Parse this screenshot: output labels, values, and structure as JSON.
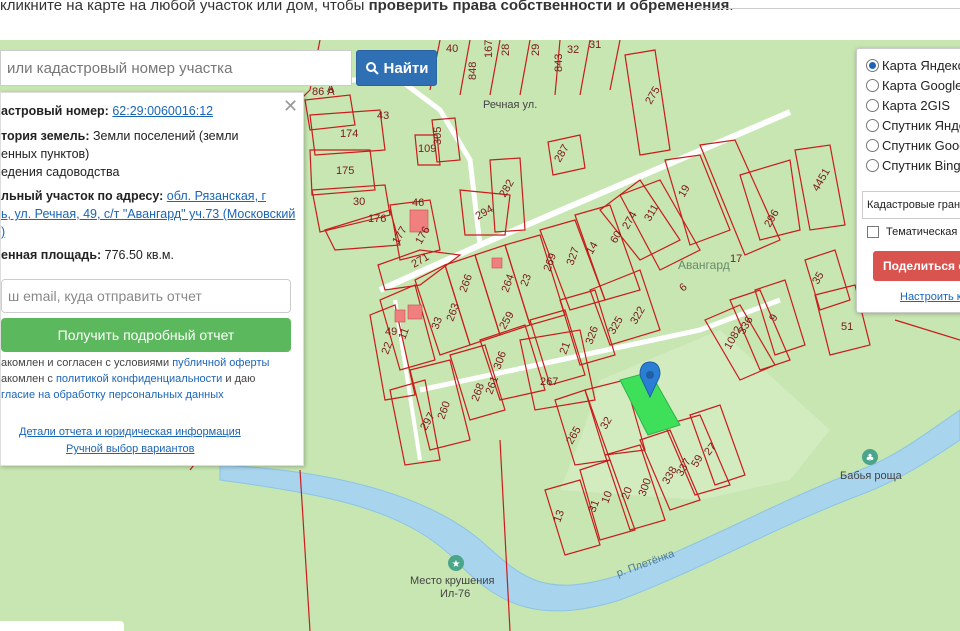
{
  "top_bar": {
    "text_prefix": "кликните на карте на любой участок или дом, чтобы ",
    "text_bold": "проверить права собственности и обременения",
    "text_suffix": "."
  },
  "search": {
    "placeholder": "или кадастровый номер участка",
    "button_label": "Найти"
  },
  "info": {
    "cadastral_label": "астровый номер: ",
    "cadastral_value": "62:29:0060016:12",
    "category_label": "тория земель: ",
    "category_value": "Земли поселений (земли",
    "category_value_2": "енных пунктов)",
    "use_value": "едения садоводства",
    "address_label": "льный участок по адресу: ",
    "address_value": "обл. Рязанская, г",
    "address_value_2": "ь, ул. Речная, 49, с/т \"Авангард\" уч.73 (Московский",
    "address_value_3": ")",
    "area_label": "енная площадь: ",
    "area_value": "776.50 кв.м.",
    "email_placeholder": "ш email, куда отправить отчет",
    "report_button": "Получить подробный отчет",
    "terms_1_prefix": "акомлен и согласен с условиями ",
    "terms_1_link": "публичной оферты",
    "terms_2_prefix": "акомлен с ",
    "terms_2_link": "политикой конфиденциальности",
    "terms_2_suffix": " и даю",
    "terms_3_link": "гласие на обработку персональных данных",
    "details_link": "Детали отчета и юридическая информация",
    "manual_link": "Ручной выбор вариантов"
  },
  "layers": {
    "options": [
      "Карта Яндекс",
      "Карта Google",
      "Карта 2GIS",
      "Спутник Яндекс",
      "Спутник Google",
      "Спутник Bing"
    ],
    "selected_index": 0,
    "select_value": "Кадастровые границы",
    "thematic_label": "Тематическая",
    "share_button": "Поделиться с",
    "setup_link": "Настроить к"
  },
  "map": {
    "colors": {
      "land": "#c7e6b2",
      "river": "#a8d4ee",
      "boundary": "#c91c1c",
      "selected": "#3ee05a",
      "marker": "#2a7fd4",
      "poi": "#4aa58a"
    },
    "street_label": "Речная ул.",
    "place_label": "Авангард",
    "river_label": "р. Плетёнка",
    "poi_1": "Бабья роща",
    "poi_2_line1": "Место крушения",
    "poi_2_line2": "Ил-76",
    "parcel_numbers": [
      "40",
      "167",
      "28",
      "29",
      "843",
      "32",
      "31",
      "86 А",
      "848",
      "174",
      "175",
      "30",
      "176",
      "177",
      "46",
      "176",
      "271",
      "109",
      "305",
      "287",
      "282",
      "294",
      "275",
      "311",
      "274",
      "60",
      "14",
      "327",
      "269",
      "23",
      "264",
      "266",
      "263",
      "33",
      "259",
      "11",
      "22",
      "21",
      "326",
      "325",
      "322",
      "306",
      "261",
      "268",
      "267",
      "260",
      "297",
      "265",
      "32",
      "300",
      "20",
      "10",
      "31",
      "13",
      "338",
      "337",
      "59",
      "27",
      "336",
      "1082",
      "9",
      "35",
      "51",
      "296",
      "4451",
      "19",
      "17",
      "6",
      "43",
      "49",
      "A"
    ]
  }
}
